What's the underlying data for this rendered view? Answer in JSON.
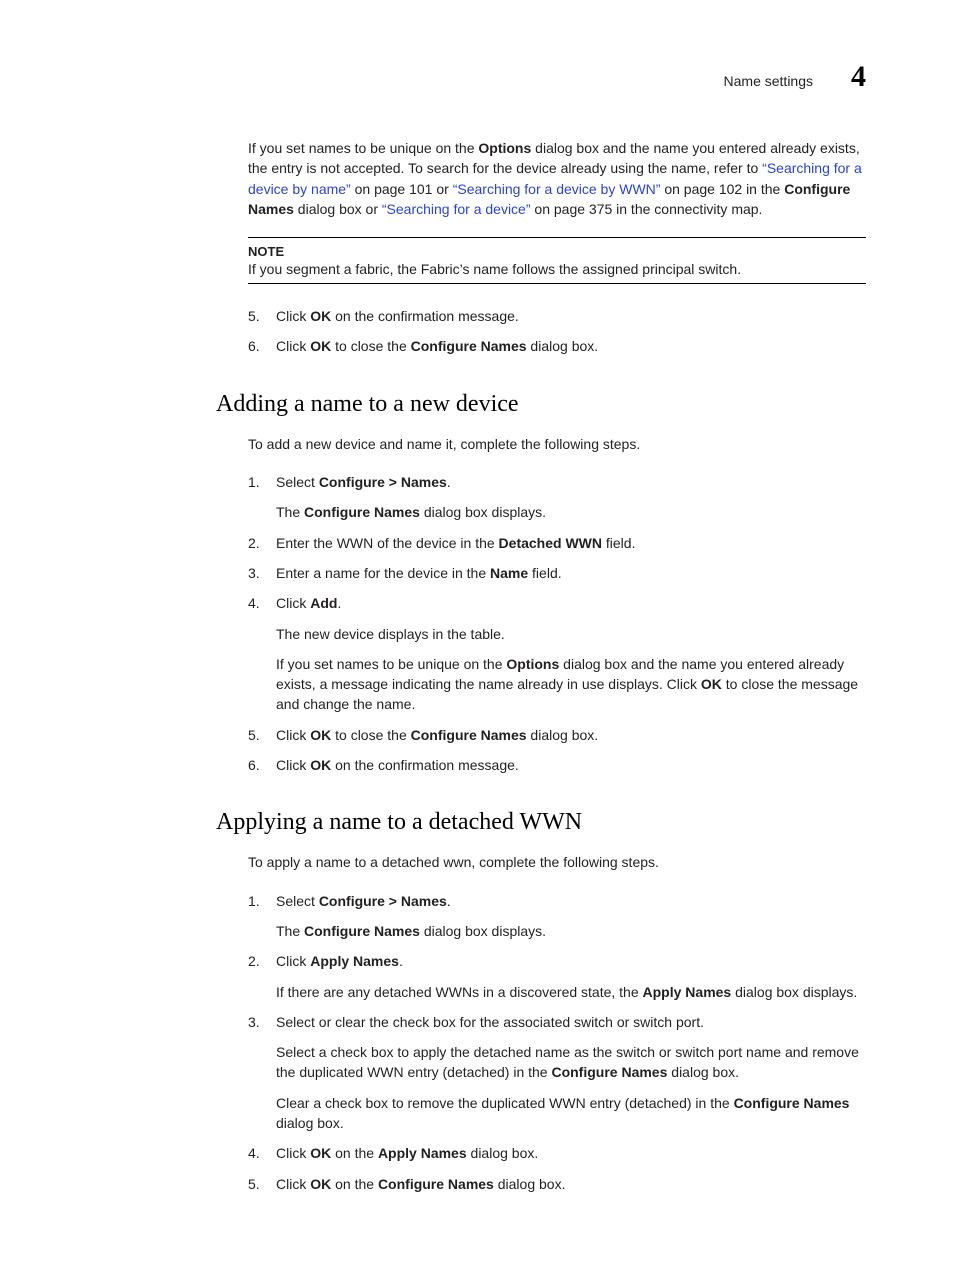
{
  "header": {
    "title": "Name settings",
    "chapter": "4"
  },
  "intro": {
    "p1_a": "If you set names to be unique on the ",
    "p1_b": "Options",
    "p1_c": " dialog box and the name you entered already exists, the entry is not accepted. To search for the device already using the name, refer to ",
    "link1": "“Searching for a device by name”",
    "p1_d": " on page 101 or ",
    "link2": "“Searching for a device by WWN”",
    "p1_e": " on page 102 in the ",
    "p1_f": "Configure Names",
    "p1_g": " dialog box or ",
    "link3": "“Searching for a device”",
    "p1_h": " on page 375 in the connectivity map."
  },
  "note": {
    "title": "NOTE",
    "body": "If you segment a fabric, the Fabric’s name follows the assigned principal switch."
  },
  "topSteps": {
    "s5_a": "Click ",
    "s5_b": "OK",
    "s5_c": " on the confirmation message.",
    "s6_a": "Click ",
    "s6_b": "OK",
    "s6_c": " to close the ",
    "s6_d": "Configure Names",
    "s6_e": " dialog box."
  },
  "section1": {
    "heading": "Adding a name to a new device",
    "intro": "To add a new device and name it, complete the following steps.",
    "s1_a": "Select ",
    "s1_b": "Configure > Names",
    "s1_c": ".",
    "s1_sub_a": "The ",
    "s1_sub_b": "Configure Names",
    "s1_sub_c": " dialog box displays.",
    "s2_a": "Enter the WWN of the device in the ",
    "s2_b": "Detached WWN",
    "s2_c": " field.",
    "s3_a": "Enter a name for the device in the ",
    "s3_b": "Name",
    "s3_c": " field.",
    "s4_a": "Click ",
    "s4_b": "Add",
    "s4_c": ".",
    "s4_sub1": "The new device displays in the table.",
    "s4_sub2_a": "If you set names to be unique on the ",
    "s4_sub2_b": "Options",
    "s4_sub2_c": " dialog box and the name you entered already exists, a message indicating the name already in use displays. Click ",
    "s4_sub2_d": "OK",
    "s4_sub2_e": " to close the message and change the name.",
    "s5_a": "Click ",
    "s5_b": "OK",
    "s5_c": " to close the ",
    "s5_d": "Configure Names",
    "s5_e": " dialog box.",
    "s6_a": "Click ",
    "s6_b": "OK",
    "s6_c": " on the confirmation message."
  },
  "section2": {
    "heading": "Applying a name to a detached WWN",
    "intro": "To apply a name to a detached wwn, complete the following steps.",
    "s1_a": "Select ",
    "s1_b": "Configure > Names",
    "s1_c": ".",
    "s1_sub_a": "The ",
    "s1_sub_b": "Configure Names",
    "s1_sub_c": " dialog box displays.",
    "s2_a": "Click ",
    "s2_b": "Apply Names",
    "s2_c": ".",
    "s2_sub_a": "If there are any detached WWNs in a discovered state, the ",
    "s2_sub_b": "Apply Names",
    "s2_sub_c": " dialog box displays.",
    "s3": "Select or clear the check box for the associated switch or switch port.",
    "s3_sub1_a": "Select a check box to apply the detached name as the switch or switch port name and remove the duplicated WWN entry (detached) in the ",
    "s3_sub1_b": "Configure Names",
    "s3_sub1_c": " dialog box.",
    "s3_sub2_a": "Clear a check box to remove the duplicated WWN entry (detached) in the ",
    "s3_sub2_b": "Configure Names",
    "s3_sub2_c": " dialog box.",
    "s4_a": "Click ",
    "s4_b": "OK",
    "s4_c": " on the ",
    "s4_d": "Apply Names",
    "s4_e": " dialog box.",
    "s5_a": "Click ",
    "s5_b": "OK",
    "s5_c": " on the ",
    "s5_d": "Configure Names",
    "s5_e": " dialog box."
  }
}
